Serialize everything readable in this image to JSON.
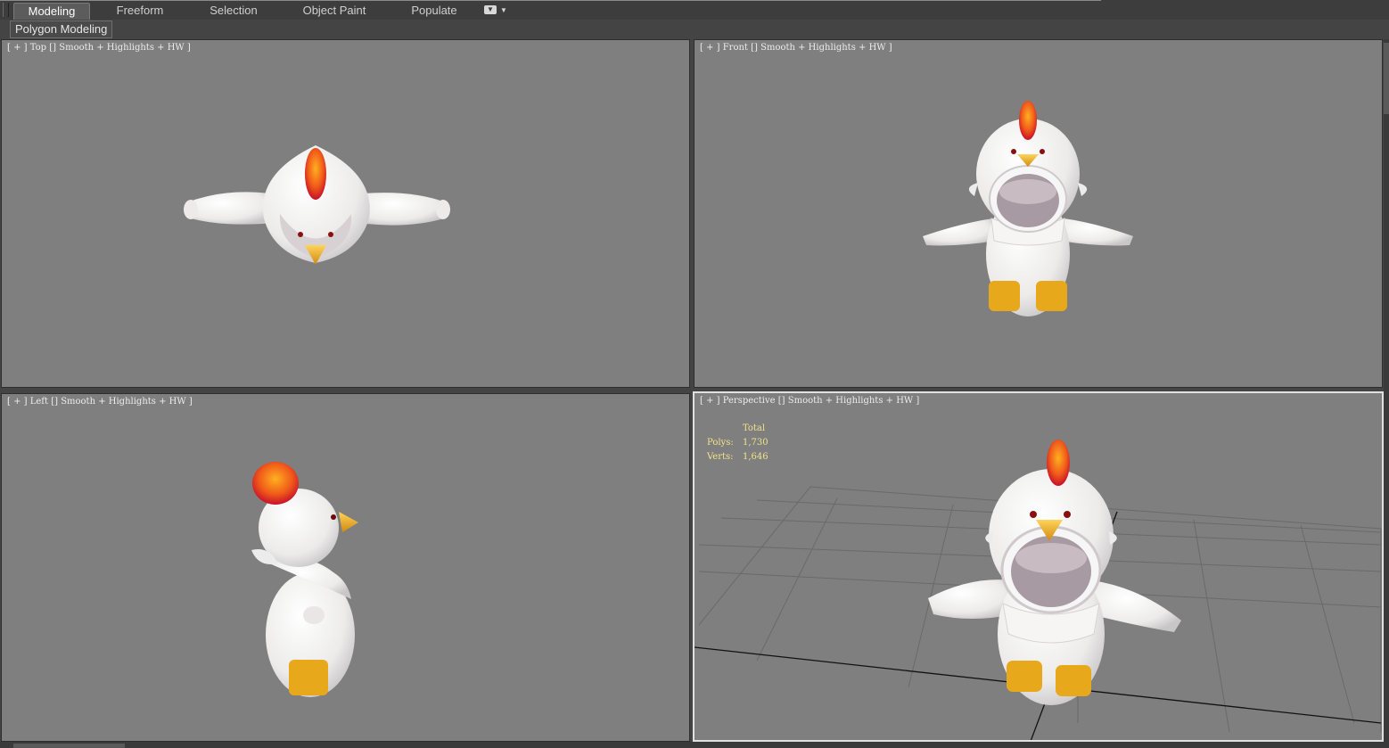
{
  "ribbon": {
    "tabs": [
      {
        "label": "Modeling",
        "active": true
      },
      {
        "label": "Freeform",
        "active": false
      },
      {
        "label": "Selection",
        "active": false
      },
      {
        "label": "Object Paint",
        "active": false
      },
      {
        "label": "Populate",
        "active": false
      }
    ],
    "options_icon": "dropdown-options-icon",
    "panel_label": "Polygon Modeling"
  },
  "viewports": {
    "top": {
      "plus": "[ + ]",
      "view": "Top",
      "shading": "Smooth + Highlights + HW ]"
    },
    "front": {
      "plus": "[ + ]",
      "view": "Front",
      "shading": "Smooth + Highlights + HW ]"
    },
    "left": {
      "plus": "[ + ]",
      "view": "Left",
      "shading": "Smooth + Highlights + HW ]"
    },
    "perspective": {
      "plus": "[ + ]",
      "view": "Perspective",
      "shading": "Smooth + Highlights + HW ]"
    }
  },
  "stats": {
    "title": "Total",
    "polys_label": "Polys:",
    "polys_value": "1,730",
    "verts_label": "Verts:",
    "verts_value": "1,646"
  },
  "colors": {
    "viewport_bg": "#7f7f7f",
    "stats_text": "#f2e28a",
    "comb": "#e2401a",
    "beak": "#f0b020",
    "body": "#f2f0ee"
  }
}
